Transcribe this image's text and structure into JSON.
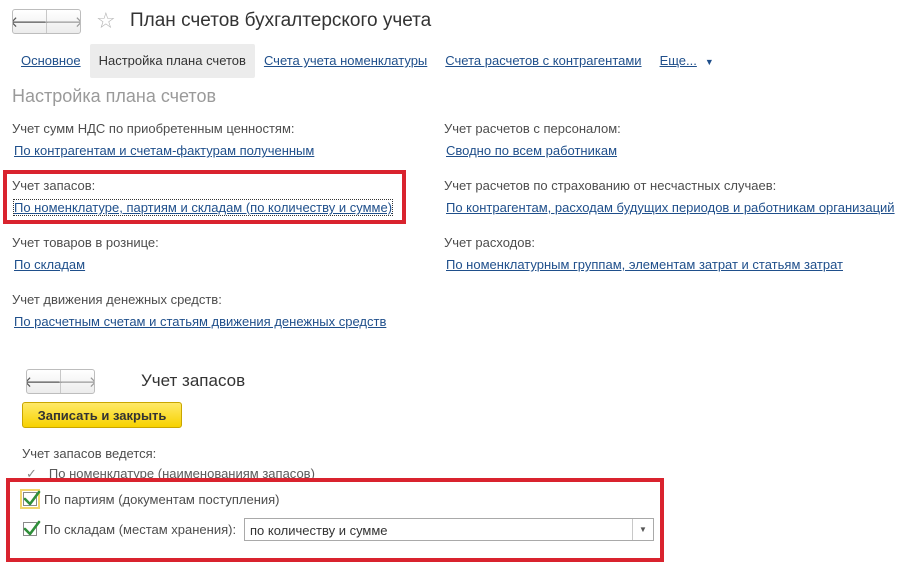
{
  "window": {
    "title": "План счетов бухгалтерского учета",
    "back_icon": "arrow-left-icon",
    "forward_icon": "arrow-right-icon",
    "favorite_icon": "star-icon"
  },
  "tabs": [
    {
      "label": "Основное",
      "active": false
    },
    {
      "label": "Настройка плана счетов",
      "active": true
    },
    {
      "label": "Счета учета номенклатуры",
      "active": false
    },
    {
      "label": "Счета расчетов с контрагентами",
      "active": false
    },
    {
      "label": "Еще...",
      "active": false
    }
  ],
  "section_title": "Настройка плана счетов",
  "settings": {
    "vat": {
      "label": "Учет сумм НДС по приобретенным ценностям:",
      "value": "По контрагентам и счетам-фактурам полученным"
    },
    "inventory": {
      "label": "Учет запасов:",
      "value": "По номенклатуре, партиям и складам (по количеству и сумме)"
    },
    "retail": {
      "label": "Учет товаров в рознице:",
      "value": "По складам"
    },
    "cash_flow": {
      "label": "Учет движения денежных средств:",
      "value": "По расчетным счетам и статьям движения денежных средств"
    },
    "personnel": {
      "label": "Учет расчетов с персоналом:",
      "value": "Сводно по всем работникам"
    },
    "insurance": {
      "label": "Учет расчетов по страхованию от несчастных случаев:",
      "value": "По контрагентам, расходам будущих периодов и работникам организаций"
    },
    "expenses": {
      "label": "Учет расходов:",
      "value": "По номенклатурным группам, элементам затрат и статьям затрат"
    }
  },
  "dialog": {
    "title": "Учет запасов",
    "save_close_label": "Записать и закрыть",
    "maintained_label": "Учет запасов ведется:",
    "by_nomenclature_label": "По номенклатуре (наименованиям запасов)",
    "by_batches": {
      "label": "По партиям (документам поступления)",
      "checked": true
    },
    "by_warehouses": {
      "label": "По складам (местам хранения):",
      "checked": true
    },
    "warehouse_mode_value": "по количеству и сумме"
  },
  "colors": {
    "link": "#1f4f8b",
    "highlight_box": "#d9232e",
    "primary_button": "#f7d200",
    "checkmark": "#2f8f3a"
  }
}
